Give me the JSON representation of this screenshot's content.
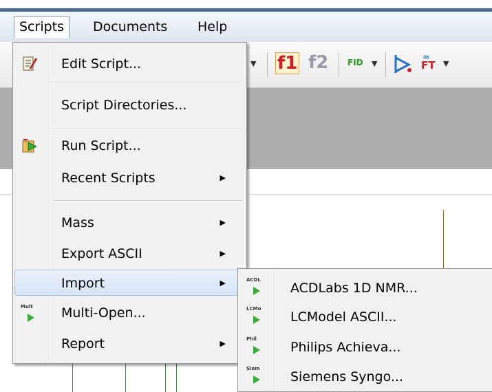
{
  "menubar": {
    "items": [
      "Scripts",
      "Documents",
      "Help"
    ]
  },
  "toolbar": {
    "f1": "f1",
    "f2": "f2",
    "fid": "FID",
    "ft": "FT"
  },
  "scripts_menu": {
    "edit_script": "Edit Script...",
    "script_directories": "Script Directories...",
    "run_script": "Run Script...",
    "recent_scripts": "Recent Scripts",
    "mass": "Mass",
    "export_ascii": "Export ASCII",
    "import": "Import",
    "multi_open": "Multi-Open...",
    "report": "Report"
  },
  "import_submenu": [
    {
      "tag": "ACDL",
      "label": "ACDLabs 1D NMR..."
    },
    {
      "tag": "LCMo",
      "label": "LCModel ASCII..."
    },
    {
      "tag": "Phil",
      "label": "Philips Achieva..."
    },
    {
      "tag": "Siem",
      "label": "Siemens Syngo..."
    }
  ],
  "multi_open_tag": "Mult",
  "icons": {
    "edit_script": "script-edit-icon",
    "run_script": "run-script-icon",
    "multi_open": "multi-open-icon",
    "submenu": "chevron-right-icon"
  }
}
